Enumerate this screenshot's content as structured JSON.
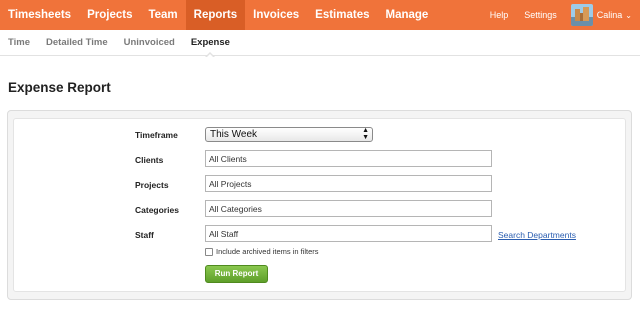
{
  "top_nav": {
    "items": [
      {
        "label": "Timesheets",
        "active": false
      },
      {
        "label": "Projects",
        "active": false
      },
      {
        "label": "Team",
        "active": false
      },
      {
        "label": "Reports",
        "active": true
      },
      {
        "label": "Invoices",
        "active": false
      },
      {
        "label": "Estimates",
        "active": false
      },
      {
        "label": "Manage",
        "active": false
      }
    ],
    "help_label": "Help",
    "settings_label": "Settings",
    "user_name": "Calina",
    "brand_color": "#f0733a",
    "active_color": "#d95e26"
  },
  "sub_nav": {
    "items": [
      {
        "label": "Time",
        "active": false
      },
      {
        "label": "Detailed Time",
        "active": false
      },
      {
        "label": "Uninvoiced",
        "active": false
      },
      {
        "label": "Expense",
        "active": true
      }
    ]
  },
  "page": {
    "title": "Expense Report"
  },
  "form": {
    "timeframe": {
      "label": "Timeframe",
      "value": "This Week"
    },
    "clients": {
      "label": "Clients",
      "value": "All Clients"
    },
    "projects": {
      "label": "Projects",
      "value": "All Projects"
    },
    "categories": {
      "label": "Categories",
      "value": "All Categories"
    },
    "staff": {
      "label": "Staff",
      "value": "All Staff"
    },
    "search_departments_label": "Search Departments",
    "include_archived_label": "Include archived items in filters",
    "include_archived_checked": false,
    "run_button_label": "Run Report"
  }
}
